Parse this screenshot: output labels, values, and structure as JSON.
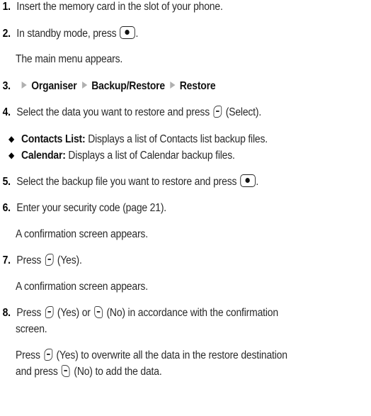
{
  "steps": {
    "s1": {
      "num": "1.",
      "text": "Insert the memory card in the slot of your phone."
    },
    "s2": {
      "num": "2.",
      "text": "In standby mode, press",
      "after": ".",
      "sub": "The main menu appears."
    },
    "s3": {
      "num": "3.",
      "path": [
        "Organiser",
        "Backup/Restore",
        "Restore"
      ]
    },
    "s4": {
      "num": "4.",
      "text": "Select the data you want to restore and press",
      "after": "(Select)."
    },
    "bullets": [
      {
        "label": "Contacts List:",
        "text": "Displays a list of Contacts list backup files."
      },
      {
        "label": "Calendar:",
        "text": "Displays a list of Calendar backup files."
      }
    ],
    "s5": {
      "num": "5.",
      "text": "Select the backup file you want to restore and press",
      "after": "."
    },
    "s6": {
      "num": "6.",
      "text": "Enter your security code (page 21).",
      "sub": "A confirmation screen appears."
    },
    "s7": {
      "num": "7.",
      "text": "Press",
      "after": "(Yes).",
      "sub": "A confirmation screen appears."
    },
    "s8": {
      "num": "8.",
      "pre": "Press",
      "mid1": "(Yes) or",
      "mid2": "(No) in accordance with the confirmation",
      "line2": "screen.",
      "p2_pre": "Press",
      "p2_mid": "(Yes) to overwrite all the data in the restore destination",
      "p2_line2_pre": "and press",
      "p2_line2_post": "(No) to add the data."
    }
  },
  "icons": {
    "center_key": "center-select-key-icon",
    "left_soft_key": "left-soft-key-icon",
    "right_soft_key": "right-soft-key-icon",
    "menu_arrow": "menu-arrow-icon",
    "bullet": "diamond-bullet-icon"
  }
}
